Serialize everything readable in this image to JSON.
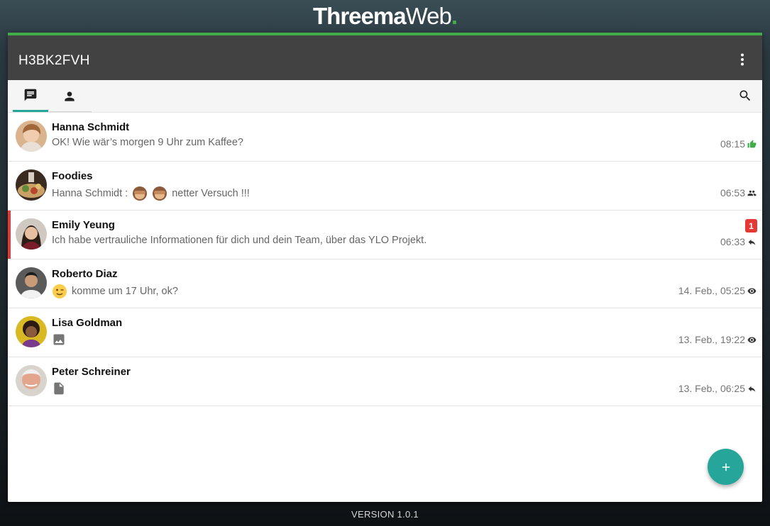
{
  "logo": {
    "brand": "Threema",
    "web": "Web",
    "dot": "."
  },
  "header": {
    "identity": "H3BK2FVH",
    "menu_icon": "more-vert-icon"
  },
  "tabs": [
    {
      "name": "conversations",
      "icon": "chat-icon",
      "active": true
    },
    {
      "name": "contacts",
      "icon": "person-icon",
      "active": false
    }
  ],
  "search_icon": "search-icon",
  "conversations": [
    {
      "name": "Hanna Schmidt",
      "preview": "OK! Wie wär’s morgen 9 Uhr zum Kaffee?",
      "time": "08:15",
      "status_icon": "thumb-up-icon",
      "status_color": "#3fae49"
    },
    {
      "name": "Foodies",
      "preview_sender": "Hanna Schmidt : ",
      "preview_text": "netter Versuch !!!",
      "time": "06:53",
      "status_icon": "group-icon"
    },
    {
      "name": "Emily Yeung",
      "preview": "Ich habe vertrauliche Informationen für dich und dein Team, über das YLO Projekt.",
      "time": "06:33",
      "status_icon": "reply-icon",
      "unread_count": "1"
    },
    {
      "name": "Roberto Diaz",
      "preview": "komme um 17 Uhr, ok?",
      "time": "14. Feb., 05:25",
      "status_icon": "eye-icon"
    },
    {
      "name": "Lisa Goldman",
      "preview_icon": "image-icon",
      "time": "13. Feb., 19:22",
      "status_icon": "eye-icon"
    },
    {
      "name": "Peter Schreiner",
      "preview_icon": "file-icon",
      "time": "13. Feb., 06:25",
      "status_icon": "reply-icon"
    }
  ],
  "fab_icon": "add-icon",
  "version": "VERSION 1.0.1",
  "colors": {
    "accent": "#3fae49",
    "teal": "#26a69a",
    "unread": "#e53935",
    "topbar": "#424242"
  }
}
